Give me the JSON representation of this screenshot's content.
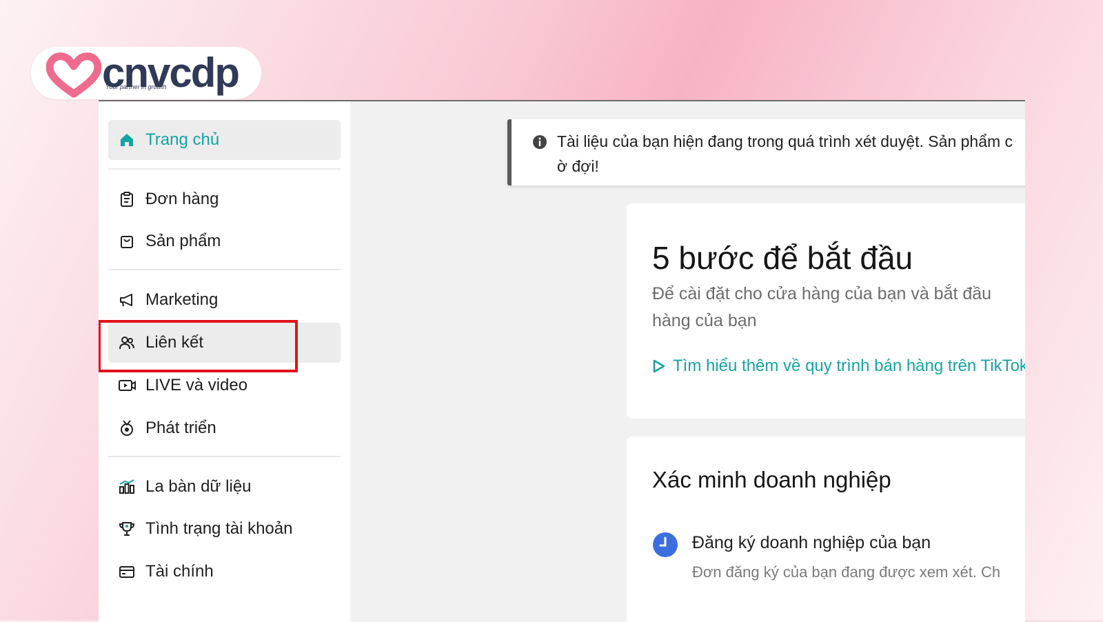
{
  "brand": {
    "name": "cnvcdp",
    "tagline": "Your partner in growth",
    "accent": "#ee6b8e",
    "text_color": "#2f3a56"
  },
  "sidebar": {
    "items": [
      {
        "label": "Trang chủ",
        "icon": "home-icon"
      },
      {
        "label": "Đơn hàng",
        "icon": "clipboard-icon"
      },
      {
        "label": "Sản phẩm",
        "icon": "shopping-bag-icon"
      },
      {
        "label": "Marketing",
        "icon": "megaphone-icon"
      },
      {
        "label": "Liên kết",
        "icon": "users-icon"
      },
      {
        "label": "LIVE và video",
        "icon": "video-icon"
      },
      {
        "label": "Phát triển",
        "icon": "growth-medal-icon"
      },
      {
        "label": "La bàn dữ liệu",
        "icon": "bar-chart-icon"
      },
      {
        "label": "Tình trạng tài khoản",
        "icon": "trophy-icon"
      },
      {
        "label": "Tài chính",
        "icon": "wallet-icon"
      }
    ],
    "active_color": "#14a3a3",
    "highlight_color": "#e0121c"
  },
  "notice": {
    "line1": "Tài liệu của bạn hiện đang trong quá trình xét duyệt. Sản phẩm c",
    "line2": "ờ đợi!"
  },
  "getting_started": {
    "title": "5 bước để bắt đầu",
    "subtitle_line1": "Để cài đặt cho cửa hàng của bạn và bắt đầu",
    "subtitle_line2": "hàng của bạn",
    "link": "Tìm hiểu thêm về quy trình bán hàng trên TikTok"
  },
  "verification": {
    "title": "Xác minh doanh nghiệp",
    "step_title": "Đăng ký doanh nghiệp của bạn",
    "step_desc": "Đơn đăng ký của bạn đang được xem xét. Ch"
  }
}
